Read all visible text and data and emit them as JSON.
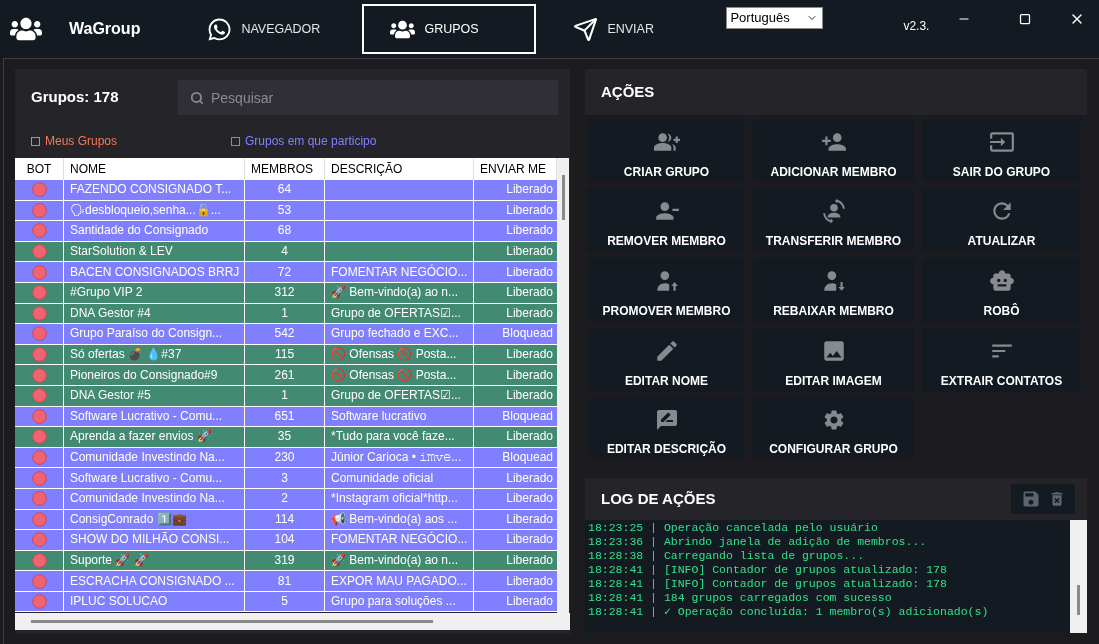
{
  "app": {
    "title": "WaGroup",
    "language": "Português",
    "version": "v2.3."
  },
  "nav_tabs": [
    {
      "label": "NAVEGADOR",
      "selected": false
    },
    {
      "label": "GRUPOS",
      "selected": true
    },
    {
      "label": "ENVIAR",
      "selected": false
    }
  ],
  "groups_panel": {
    "title": "Grupos: 178",
    "search": {
      "placeholder": "Pesquisar"
    },
    "legend": [
      {
        "label": "Meus Grupos",
        "color": "#f2795c"
      },
      {
        "label": "Grupos em que participo",
        "color": "#8080ff"
      }
    ]
  },
  "table": {
    "columns": [
      "BOT",
      "NOME",
      "MEMBROS",
      "DESCRIÇÃO",
      "ENVIAR ME"
    ],
    "rows": [
      {
        "color": "#8080ff",
        "bot": false,
        "name": "FAZENDO CONSIGNADO T...",
        "members": "64",
        "sending": "Liberado"
      },
      {
        "color": "#8080ff",
        "bot": false,
        "name": "🗣desbloqueio,senha...🔓...",
        "members": "53",
        "sending": "Liberado"
      },
      {
        "color": "#8080ff",
        "bot": false,
        "name": "Santidade do Consignado",
        "members": "68",
        "sending": "Liberado"
      },
      {
        "color": "#438a72",
        "bot": false,
        "name": "StarSolution & LEV",
        "members": "4",
        "sending": "Liberado"
      },
      {
        "color": "#8080ff",
        "bot": false,
        "name": "BACEN CONSIGNADOS BRRJ",
        "members": "72",
        "description": "FOMENTAR NEGÓCIO...",
        "sending": "Liberado"
      },
      {
        "color": "#438a72",
        "bot": false,
        "name": "#Grupo VIP 2",
        "members": "312",
        "description": "🚀 Bem-vindo(a) ao n...",
        "sending": "Liberado"
      },
      {
        "color": "#438a72",
        "bot": false,
        "name": "DNA Gestor #4",
        "members": "1",
        "description": "Grupo de OFERTAS☑...",
        "sending": "Liberado"
      },
      {
        "color": "#8080ff",
        "bot": false,
        "name": "Grupo Paraíso do Consign...",
        "members": "542",
        "description": "Grupo fechado e EXC...",
        "sending": "Bloquead"
      },
      {
        "color": "#438a72",
        "bot": false,
        "name": "Só ofertas 💣 💧#37",
        "members": "115",
        "description": "🚫 Ofensas 🚫 Posta...",
        "sending": "Liberado"
      },
      {
        "color": "#438a72",
        "bot": false,
        "name": "Pioneiros do Consignado#9",
        "members": "261",
        "description": "🚫 Ofensas 🚫 Posta...",
        "sending": "Liberado"
      },
      {
        "color": "#438a72",
        "bot": false,
        "name": "DNA Gestor #5",
        "members": "1",
        "description": "Grupo de OFERTAS☑...",
        "sending": "Liberado"
      },
      {
        "color": "#8080ff",
        "bot": false,
        "name": "Software Lucrativo - Comu...",
        "members": "651",
        "description": "Software lucrativo",
        "sending": "Bloquead"
      },
      {
        "color": "#438a72",
        "bot": false,
        "name": "Aprenda a fazer envios 🚀",
        "members": "35",
        "description": "*Tudo para você faze...",
        "sending": "Liberado"
      },
      {
        "color": "#8080ff",
        "bot": false,
        "name": "Comunidade Investindo Na...",
        "members": "230",
        "description": "Júnior Carioca • 𝚒𝚖𝚟𝚎...",
        "sending": "Bloquead"
      },
      {
        "color": "#8080ff",
        "bot": false,
        "name": "Software Lucrativo - Comu...",
        "members": "3",
        "description": "Comunidade oficial",
        "sending": "Liberado"
      },
      {
        "color": "#8080ff",
        "bot": false,
        "name": "Comunidade Investindo Na...",
        "members": "2",
        "description": "*Instagram oficial*http...",
        "sending": "Liberado"
      },
      {
        "color": "#8080ff",
        "bot": false,
        "name": "ConsigConrado 1️⃣💼",
        "members": "114",
        "description": "📢 Bem-vindo(a) aos ...",
        "sending": "Liberado"
      },
      {
        "color": "#8080ff",
        "bot": false,
        "name": "SHOW DO MILHÃO CONSI...",
        "members": "104",
        "description": "FOMENTAR NEGÓCIO...",
        "sending": "Liberado"
      },
      {
        "color": "#438a72",
        "bot": false,
        "name": "Suporte 🚀 🚀",
        "members": "319",
        "description": "🚀 Bem-vindo(a) ao n...",
        "sending": "Liberado"
      },
      {
        "color": "#8080ff",
        "bot": false,
        "name": "ESCRACHA CONSIGNADO ...",
        "members": "81",
        "description": "EXPOR MAU PAGADO...",
        "sending": "Liberado"
      },
      {
        "color": "#8080ff",
        "bot": false,
        "name": "IPLUC SOLUCAO",
        "members": "5",
        "description": "Grupo para soluções ...",
        "sending": "Liberado"
      }
    ]
  },
  "actions": {
    "title": "AÇÕES",
    "buttons": [
      "CRIAR GRUPO",
      "ADICIONAR MEMBRO",
      "SAIR DO GRUPO",
      "REMOVER MEMBRO",
      "TRANSFERIR MEMBRO",
      "ATUALIZAR",
      "PROMOVER MEMBRO",
      "REBAIXAR MEMBRO",
      "ROBÔ",
      "EDITAR NOME",
      "EDITAR IMAGEM",
      "EXTRAIR CONTATOS",
      "EDITAR DESCRIÇÃO",
      "CONFIGURAR GRUPO"
    ]
  },
  "log": {
    "title": "LOG DE AÇÕES",
    "lines": [
      "18:23:25 | Operação cancelada pelo usuário",
      "18:23:36 | Abrindo janela de adição de membros...",
      "18:28:38 | Carregando lista de grupos...",
      "18:28:41 | [INFO] Contador de grupos atualizado: 178",
      "18:28:41 | [INFO] Contador de grupos atualizado: 178",
      "18:28:41 | 184 grupos carregados com sucesso",
      "18:28:41 | ✓ Operação concluída: 1 membro(s) adicionado(s)"
    ]
  }
}
